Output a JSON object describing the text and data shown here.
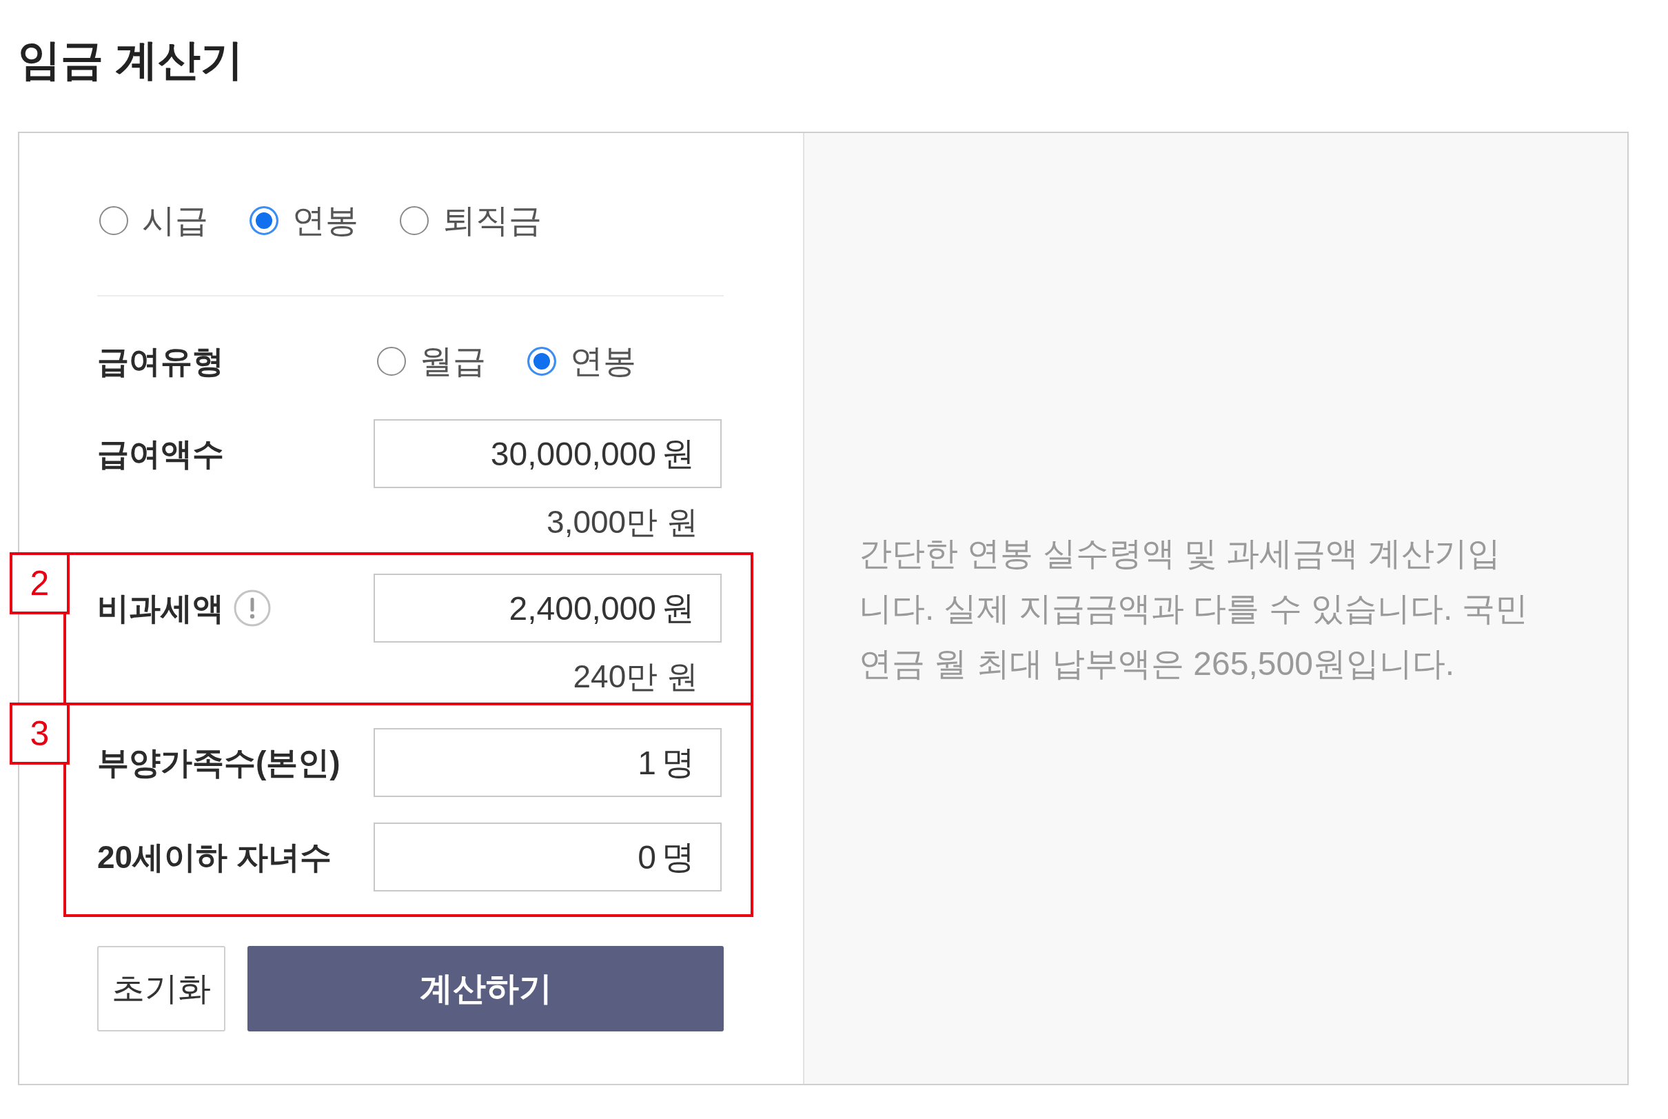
{
  "title": "임금 계산기",
  "calc_types": [
    {
      "label": "시급",
      "selected": false
    },
    {
      "label": "연봉",
      "selected": true
    },
    {
      "label": "퇴직금",
      "selected": false
    }
  ],
  "form_sections": [
    {
      "rows": [
        {
          "kind": "radio",
          "label": "급여유형",
          "options": [
            {
              "label": "월급",
              "selected": false
            },
            {
              "label": "연봉",
              "selected": true
            }
          ]
        },
        {
          "kind": "input",
          "label": "급여액수",
          "info_icon": false,
          "value": "30,000,000",
          "unit": "원",
          "note": "3,000만 원"
        }
      ]
    },
    {
      "annotation": "2",
      "rows": [
        {
          "kind": "input",
          "label": "비과세액",
          "info_icon": true,
          "value": "2,400,000",
          "unit": "원",
          "note": "240만 원"
        }
      ]
    },
    {
      "annotation": "3",
      "rows": [
        {
          "kind": "input",
          "label": "부양가족수(본인)",
          "info_icon": false,
          "value": "1",
          "unit": "명"
        },
        {
          "kind": "input",
          "label": "20세이하 자녀수",
          "info_icon": false,
          "value": "0",
          "unit": "명"
        }
      ]
    }
  ],
  "buttons": [
    {
      "kind": "secondary",
      "label": "초기화"
    },
    {
      "kind": "primary",
      "label": "계산하기"
    }
  ],
  "description": "간단한 연봉 실수령액 및 과세금액 계산기입니다. 실제 지급금액과 다를 수 있습니다. 국민연금 월 최대 납부액은 265,500원입니다."
}
